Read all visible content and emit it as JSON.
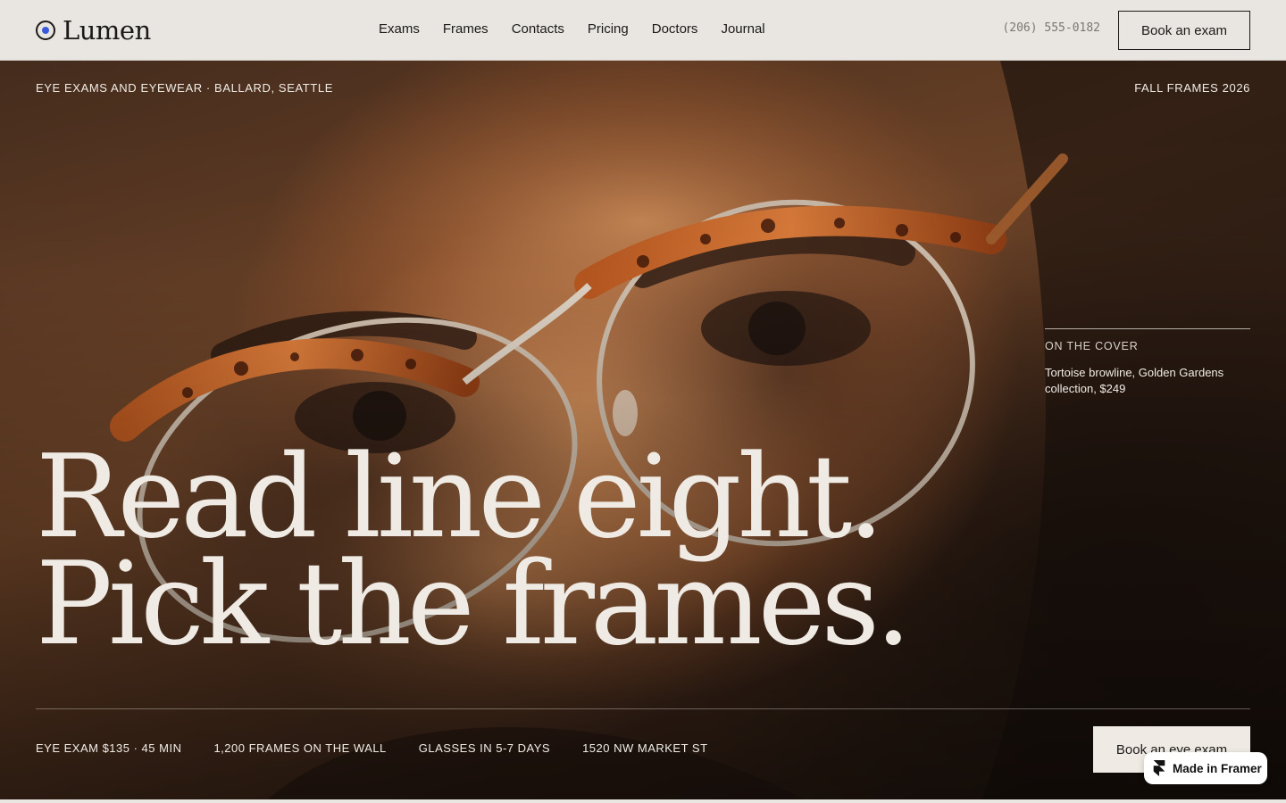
{
  "brand": {
    "name": "Lumen",
    "logo_icon": "eye-circle-icon",
    "accent_color": "#3a5bd9"
  },
  "nav": {
    "items": [
      {
        "label": "Exams"
      },
      {
        "label": "Frames"
      },
      {
        "label": "Contacts"
      },
      {
        "label": "Pricing"
      },
      {
        "label": "Doctors"
      },
      {
        "label": "Journal"
      }
    ],
    "phone": "(206) 555-0182",
    "cta_label": "Book an exam"
  },
  "hero": {
    "eyebrow_left": "Eye exams and eyewear · Ballard, Seattle",
    "eyebrow_right": "Fall frames 2026",
    "cover": {
      "kicker": "On the cover",
      "description": "Tortoise browline, Golden Gardens collection, $249"
    },
    "headline": {
      "line1": "Read line eight.",
      "line2": "Pick the frames."
    },
    "facts": [
      "Eye exam $135 · 45 min",
      "1,200 frames on the wall",
      "Glasses in 5-7 days",
      "1520 NW Market St"
    ],
    "cta_label": "Book an eye exam"
  },
  "badge": {
    "label": "Made in Framer",
    "icon": "framer-logo-icon"
  }
}
